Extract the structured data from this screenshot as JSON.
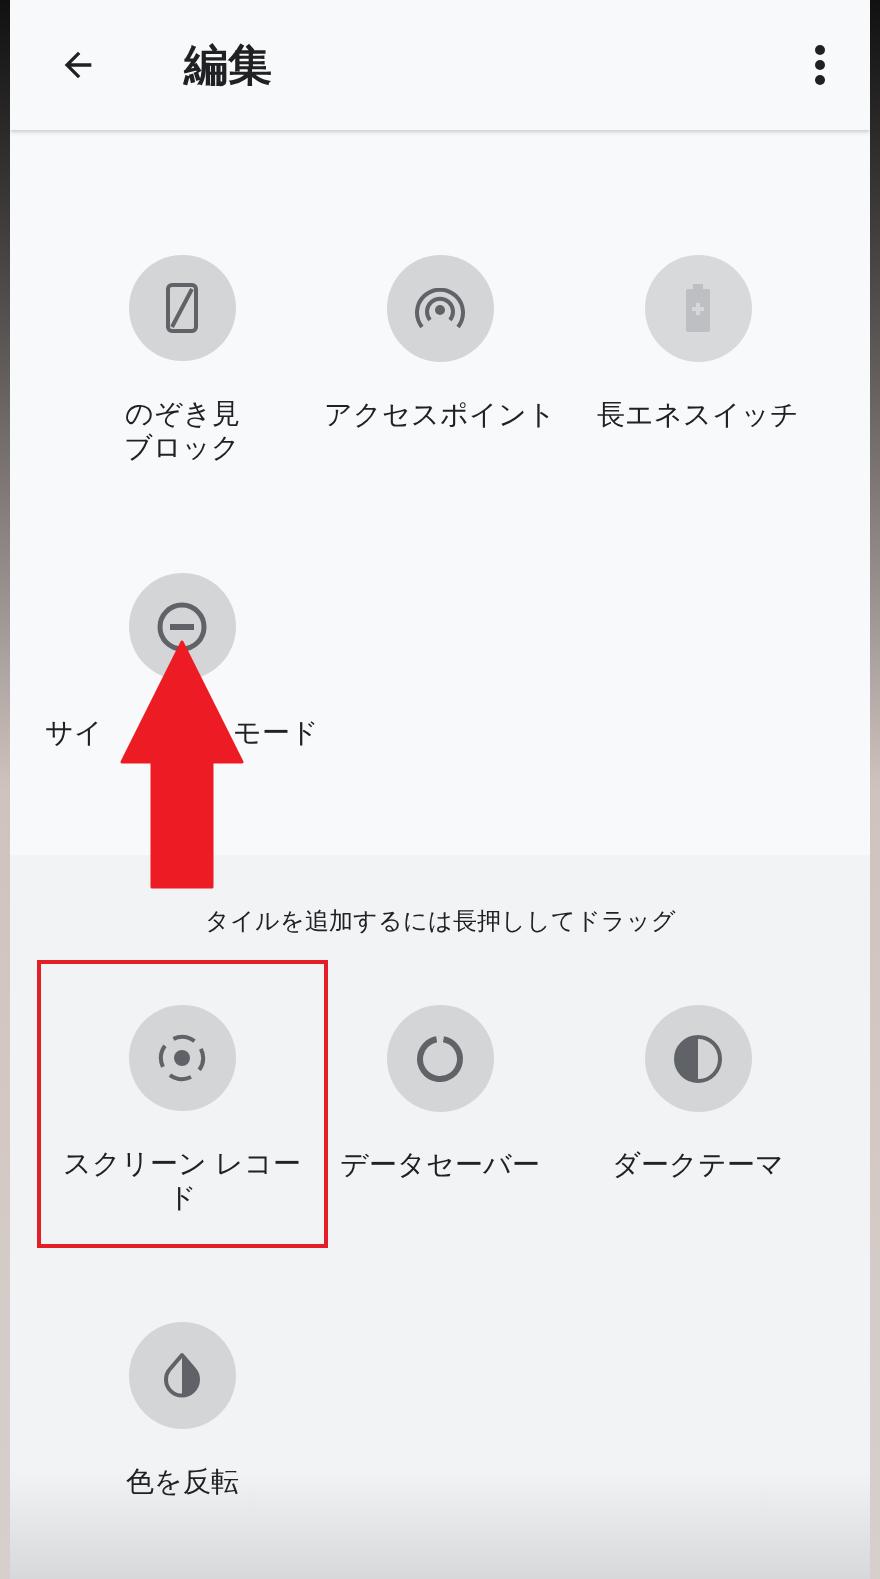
{
  "header": {
    "title": "編集"
  },
  "active_tiles": [
    {
      "label_lines": [
        "のぞき見",
        "ブロック"
      ],
      "dimmed": false
    },
    {
      "label_lines": [
        "アクセスポイント"
      ],
      "dimmed": false
    },
    {
      "label_lines": [
        "長エネスイッチ"
      ],
      "dimmed": true
    },
    {
      "label_parts": [
        "サイ",
        "モード"
      ],
      "dimmed": false
    }
  ],
  "available_section": {
    "hint": "タイルを追加するには長押ししてドラッグ"
  },
  "available_tiles": [
    {
      "label_lines": [
        "スクリーン レコード"
      ],
      "dimmed": false,
      "highlighted": true
    },
    {
      "label_lines": [
        "データセーバー"
      ],
      "dimmed": false,
      "highlighted": false
    },
    {
      "label_lines": [
        "ダークテーマ"
      ],
      "dimmed": false,
      "highlighted": false
    },
    {
      "label_lines": [
        "色を反転"
      ],
      "dimmed": false,
      "highlighted": false
    }
  ],
  "annotations": [
    {
      "kind": "arrow"
    }
  ]
}
